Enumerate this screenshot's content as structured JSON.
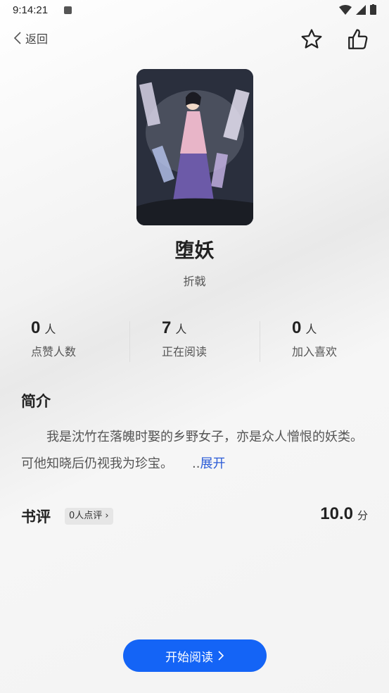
{
  "status_bar": {
    "time": "9:14:21"
  },
  "nav": {
    "back_label": "返回"
  },
  "book": {
    "title": "堕妖",
    "author": "折戟"
  },
  "stats": [
    {
      "value": "0",
      "unit": "人",
      "label": "点赞人数"
    },
    {
      "value": "7",
      "unit": "人",
      "label": "正在阅读"
    },
    {
      "value": "0",
      "unit": "人",
      "label": "加入喜欢"
    }
  ],
  "intro": {
    "title": "简介",
    "text": "　　我是沈竹在落魄时娶的乡野女子，亦是众人憎恨的妖类。　　可他知晓后仍视我为珍宝。　　..",
    "more_label": "展开"
  },
  "review": {
    "title": "书评",
    "chip_label": "0人点评",
    "score": "10.0",
    "score_unit": "分"
  },
  "actions": {
    "start_reading": "开始阅读"
  },
  "colors": {
    "accent": "#1464f6",
    "link": "#2a5bd7"
  }
}
